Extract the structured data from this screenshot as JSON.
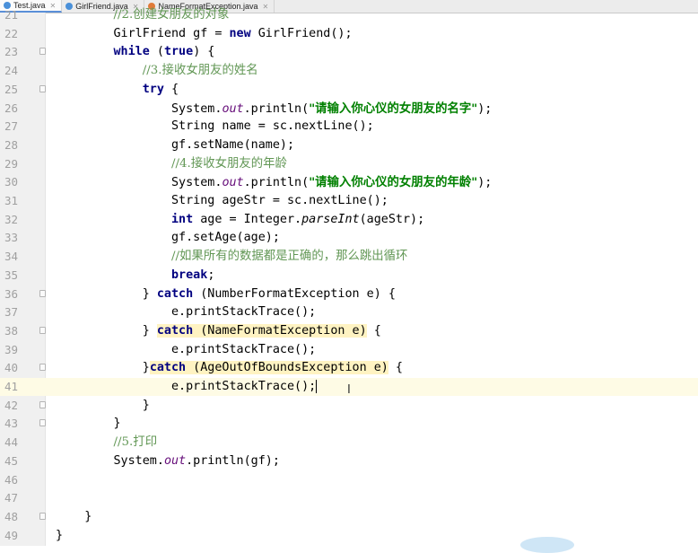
{
  "tabs": [
    {
      "label": "Test.java",
      "icon": "java-class-icon"
    },
    {
      "label": "GirlFriend.java",
      "icon": "java-class-icon"
    },
    {
      "label": "NameFormatException.java",
      "icon": "java-exception-icon"
    }
  ],
  "editor": {
    "lines": [
      {
        "n": "21",
        "text": "        //2.创建女朋友的对象"
      },
      {
        "n": "22",
        "text": "        GirlFriend gf = new GirlFriend();"
      },
      {
        "n": "23",
        "text": "        while (true) {"
      },
      {
        "n": "24",
        "text": "            //3.接收女朋友的姓名"
      },
      {
        "n": "25",
        "text": "            try {"
      },
      {
        "n": "26",
        "text": "                System.out.println(\"请输入你心仪的女朋友的名字\");"
      },
      {
        "n": "27",
        "text": "                String name = sc.nextLine();"
      },
      {
        "n": "28",
        "text": "                gf.setName(name);"
      },
      {
        "n": "29",
        "text": "                //4.接收女朋友的年龄"
      },
      {
        "n": "30",
        "text": "                System.out.println(\"请输入你心仪的女朋友的年龄\");"
      },
      {
        "n": "31",
        "text": "                String ageStr = sc.nextLine();"
      },
      {
        "n": "32",
        "text": "                int age = Integer.parseInt(ageStr);"
      },
      {
        "n": "33",
        "text": "                gf.setAge(age);"
      },
      {
        "n": "34",
        "text": "                //如果所有的数据都是正确的，那么跳出循环"
      },
      {
        "n": "35",
        "text": "                break;"
      },
      {
        "n": "36",
        "text": "            } catch (NumberFormatException e) {"
      },
      {
        "n": "37",
        "text": "                e.printStackTrace();"
      },
      {
        "n": "38",
        "text": "            } catch (NameFormatException e) {"
      },
      {
        "n": "39",
        "text": "                e.printStackTrace();"
      },
      {
        "n": "40",
        "text": "            }catch (AgeOutOfBoundsException e) {"
      },
      {
        "n": "41",
        "text": "                e.printStackTrace();"
      },
      {
        "n": "42",
        "text": "            }"
      },
      {
        "n": "43",
        "text": "        }"
      },
      {
        "n": "44",
        "text": "        //5.打印"
      },
      {
        "n": "45",
        "text": "        System.out.println(gf);"
      },
      {
        "n": "46",
        "text": ""
      },
      {
        "n": "47",
        "text": ""
      },
      {
        "n": "48",
        "text": "    }"
      },
      {
        "n": "49",
        "text": "}"
      }
    ]
  },
  "colors": {
    "keyword": "#000080",
    "string": "#008000",
    "field": "#660e7a",
    "comment": "#629755",
    "highlight": "#fff3c2",
    "current_line": "#fefbe5"
  }
}
